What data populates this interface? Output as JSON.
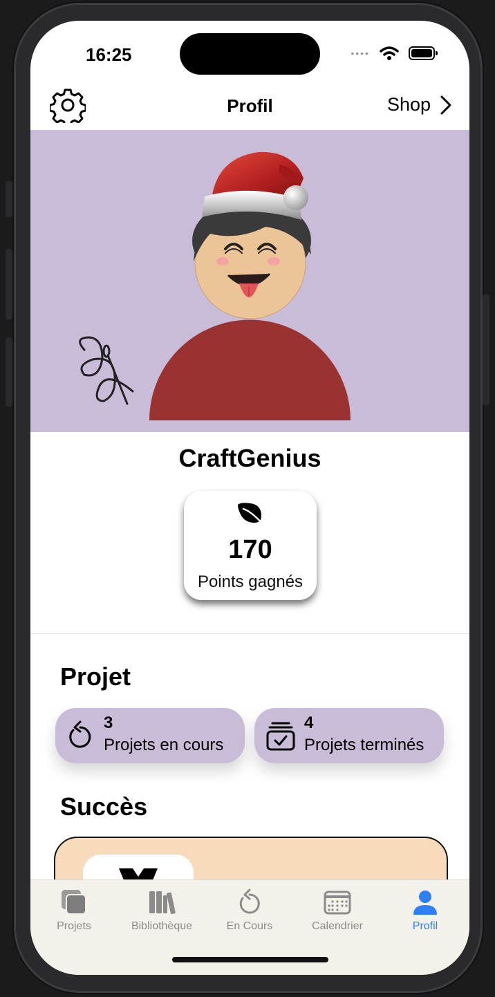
{
  "status_bar": {
    "time": "16:25"
  },
  "nav": {
    "title": "Profil",
    "shop_label": "Shop"
  },
  "profile": {
    "username": "CraftGenius",
    "points_value": "170",
    "points_label": "Points gagnés"
  },
  "projects": {
    "title": "Projet",
    "in_progress": {
      "count": "3",
      "label": "Projets en cours"
    },
    "completed": {
      "count": "4",
      "label": "Projets terminés"
    }
  },
  "success": {
    "title": "Succès"
  },
  "tabs": [
    {
      "label": "Projets",
      "icon": "stack-icon"
    },
    {
      "label": "Bibliothèque",
      "icon": "books-icon"
    },
    {
      "label": "En Cours",
      "icon": "refresh-icon"
    },
    {
      "label": "Calendrier",
      "icon": "calendar-icon"
    },
    {
      "label": "Profil",
      "icon": "person-icon"
    }
  ],
  "colors": {
    "banner": "#c9bcd8",
    "pill": "#c9bcd8",
    "success_card": "#f8dabc",
    "tab_active": "#2f7ff5",
    "tab_inactive": "#8b8b8b",
    "avatar_body": "#9b3232"
  }
}
